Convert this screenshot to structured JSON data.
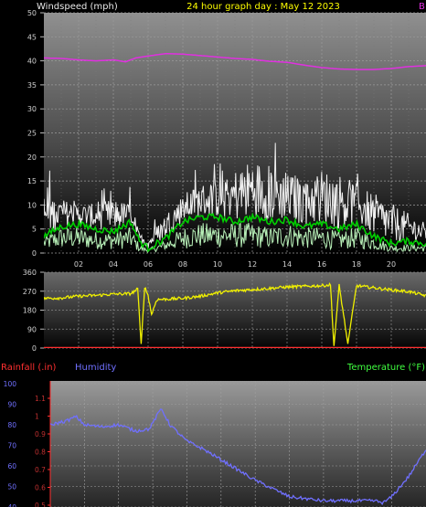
{
  "header": {
    "panel_title": "Windspeed (mph)",
    "graph_title": "24 hour graph day : May 12 2023",
    "edge_label": "B"
  },
  "colors": {
    "wind_gust": "#f0f0f0",
    "wind_avg": "#00d000",
    "wind_light": "#b8f0b8",
    "barometer": "#e030e0",
    "direction": "#f0f000",
    "rain": "#ff3030",
    "humidity": "#7070ff",
    "temperature": "#40ff40",
    "title_yellow": "#ffff00",
    "axis_text": "#d0d0d0",
    "bottom_axis_text": "#c03030",
    "left_axis_text": "#7070ff"
  },
  "chart_data": [
    {
      "type": "line",
      "ylabel": "Windspeed (mph)",
      "ylim": [
        0,
        50
      ],
      "yticks": [
        0,
        5,
        10,
        15,
        20,
        25,
        30,
        35,
        40,
        45,
        50
      ],
      "xlim": [
        0,
        22
      ],
      "xticks": [
        "02",
        "04",
        "06",
        "08",
        "10",
        "12",
        "14",
        "16",
        "18",
        "20"
      ],
      "grid": true,
      "series": [
        {
          "key": "barometer_trace",
          "x": [
            0,
            1,
            2,
            3,
            4,
            4.7,
            5.3,
            6,
            7,
            8,
            9,
            10,
            11,
            12,
            13,
            14,
            15,
            16,
            17,
            18,
            19,
            20,
            21,
            22
          ],
          "values": [
            40.6,
            40.5,
            40.2,
            40.0,
            40.2,
            39.8,
            40.6,
            41.0,
            41.5,
            41.4,
            41.1,
            40.8,
            40.5,
            40.3,
            39.9,
            39.7,
            39.1,
            38.6,
            38.3,
            38.2,
            38.2,
            38.4,
            38.8,
            39.0
          ]
        },
        {
          "key": "gust_upper",
          "x": [
            0,
            1,
            2,
            3,
            4,
            5,
            5.5,
            6,
            7,
            8,
            9,
            10,
            11,
            12,
            13,
            14,
            15,
            16,
            17,
            18,
            19,
            20,
            21,
            22
          ],
          "values": [
            12,
            11,
            10,
            10,
            11,
            10,
            4,
            3,
            8,
            12,
            14,
            15,
            17,
            19,
            18,
            16,
            16,
            17,
            16,
            14,
            12,
            10,
            8,
            6
          ]
        },
        {
          "key": "average",
          "x": [
            0,
            1,
            2,
            3,
            4,
            5,
            5.5,
            6,
            7,
            8,
            9,
            10,
            11,
            12,
            13,
            14,
            15,
            16,
            17,
            18,
            19,
            20,
            21,
            22
          ],
          "values": [
            3.5,
            5.5,
            6,
            5,
            4.5,
            6.5,
            2.5,
            1,
            3,
            6.5,
            7.5,
            7.5,
            6.5,
            7.5,
            6.5,
            7,
            5.5,
            6,
            5,
            6,
            3.5,
            2,
            2.5,
            2
          ]
        },
        {
          "key": "lull",
          "x": [
            0,
            1,
            2,
            3,
            4,
            5,
            5.5,
            6,
            7,
            8,
            9,
            10,
            11,
            12,
            13,
            14,
            15,
            16,
            17,
            18,
            19,
            20,
            21,
            22
          ],
          "values": [
            2,
            3,
            3,
            2.5,
            2.5,
            3,
            1,
            0.5,
            1.5,
            3,
            3.5,
            3.5,
            3.5,
            3.5,
            3,
            3.5,
            3,
            3,
            2.5,
            3,
            2,
            1,
            1,
            1
          ]
        }
      ]
    },
    {
      "type": "line",
      "ylim": [
        0,
        360
      ],
      "yticks": [
        0,
        90,
        180,
        270,
        360
      ],
      "xlim": [
        0,
        22
      ],
      "grid": true,
      "series": [
        {
          "key": "wind_direction",
          "x": [
            0,
            1,
            2,
            3,
            4,
            5,
            5.4,
            5.6,
            5.8,
            6,
            6.2,
            6.5,
            7,
            8,
            9,
            10,
            11,
            12,
            13,
            14,
            15,
            16,
            16.5,
            16.7,
            17,
            17.5,
            18,
            19,
            20,
            21,
            22
          ],
          "values": [
            236,
            238,
            246,
            250,
            256,
            258,
            280,
            20,
            290,
            250,
            160,
            230,
            232,
            236,
            246,
            262,
            272,
            278,
            283,
            290,
            293,
            296,
            300,
            10,
            298,
            20,
            296,
            286,
            276,
            268,
            248
          ]
        },
        {
          "key": "rain_daily",
          "x": [
            0,
            22
          ],
          "values": [
            0,
            0
          ]
        }
      ]
    },
    {
      "type": "line",
      "xlim": [
        0,
        22
      ],
      "grid": true,
      "axes": {
        "left_label": "Rainfall (.in)",
        "mid_label": "Humidity",
        "right_label": "Temperature (°F)",
        "left_ticks": [
          "100",
          "90",
          "80",
          "70",
          "60",
          "50",
          "40"
        ],
        "inner_ticks": [
          "1.1",
          "1",
          "0.9",
          "0.8",
          "0.7",
          "0.6",
          "0.5"
        ]
      },
      "humidity_ylim": [
        40,
        100
      ],
      "series": [
        {
          "key": "humidity",
          "x": [
            0,
            1,
            1.5,
            2,
            3,
            4,
            5,
            5.8,
            6.5,
            7,
            8,
            9,
            10,
            11,
            12,
            13,
            14,
            15,
            16,
            17,
            18,
            19,
            19.5,
            20,
            21,
            22
          ],
          "values": [
            80,
            82,
            84,
            80,
            79,
            80,
            77,
            78,
            88,
            80,
            72,
            68,
            63,
            58,
            53,
            49,
            45,
            44,
            43,
            43,
            43,
            43,
            42,
            45,
            55,
            68
          ]
        }
      ]
    }
  ]
}
